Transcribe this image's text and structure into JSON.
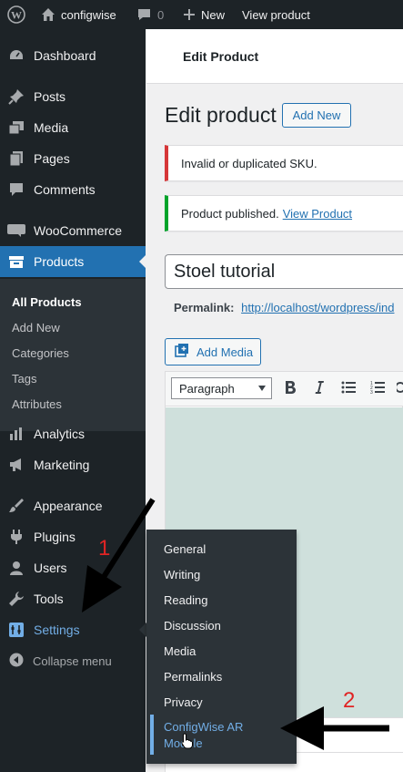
{
  "adminbar": {
    "site_name": "configwise",
    "comments_count": "0",
    "new_label": "New",
    "view_label": "View product",
    "icons": [
      "wordpress-icon",
      "home-icon",
      "comment-icon",
      "plus-icon"
    ]
  },
  "sidebar": {
    "items": [
      {
        "label": "Dashboard",
        "icon": "dashboard-icon"
      },
      {
        "label": "Posts",
        "icon": "pin-icon"
      },
      {
        "label": "Media",
        "icon": "media-icon"
      },
      {
        "label": "Pages",
        "icon": "pages-icon"
      },
      {
        "label": "Comments",
        "icon": "comment-icon"
      },
      {
        "label": "WooCommerce",
        "icon": "woo-icon"
      },
      {
        "label": "Products",
        "icon": "products-icon"
      },
      {
        "label": "Analytics",
        "icon": "analytics-icon"
      },
      {
        "label": "Marketing",
        "icon": "megaphone-icon"
      },
      {
        "label": "Appearance",
        "icon": "brush-icon"
      },
      {
        "label": "Plugins",
        "icon": "plugin-icon"
      },
      {
        "label": "Users",
        "icon": "user-icon"
      },
      {
        "label": "Tools",
        "icon": "wrench-icon"
      },
      {
        "label": "Settings",
        "icon": "settings-icon"
      }
    ],
    "products_submenu": [
      "All Products",
      "Add New",
      "Categories",
      "Tags",
      "Attributes"
    ],
    "collapse_label": "Collapse menu"
  },
  "main": {
    "top_title": "Edit Product",
    "heading": "Edit product",
    "add_new": "Add New",
    "notice_error": "Invalid or duplicated SKU.",
    "notice_success": "Product published.",
    "notice_success_link": "View Product",
    "title_value": "Stoel tutorial",
    "permalink_label": "Permalink:",
    "permalink_url": "http://localhost/wordpress/ind",
    "add_media": "Add Media",
    "format_select": "Paragraph"
  },
  "settings_flyout": {
    "items": [
      "General",
      "Writing",
      "Reading",
      "Discussion",
      "Media",
      "Permalinks",
      "Privacy"
    ],
    "highlighted_line1": "ConfigWise AR",
    "highlighted_line2": "Module"
  },
  "annotations": {
    "step1": "1",
    "step2": "2",
    "color": "#e02424"
  },
  "colors": {
    "admin_dark": "#1d2327",
    "submenu_bg": "#2c3338",
    "accent": "#2271b1",
    "link_light": "#72aee6",
    "error": "#d63638",
    "success": "#00a32a"
  }
}
